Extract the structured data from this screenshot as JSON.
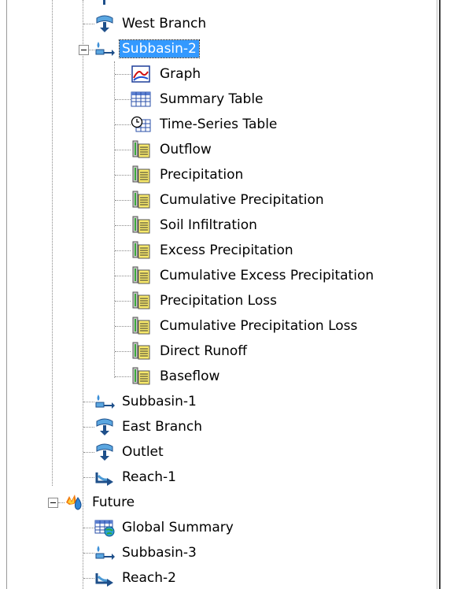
{
  "tree": {
    "nodes": [
      {
        "label": "West Branch",
        "icon": "junction-icon"
      },
      {
        "label": "Subbasin-2",
        "icon": "subbasin-icon",
        "selected": true,
        "expanded": true
      },
      {
        "label": "Graph",
        "icon": "graph-icon"
      },
      {
        "label": "Summary Table",
        "icon": "summary-table-icon"
      },
      {
        "label": "Time-Series Table",
        "icon": "time-series-table-icon"
      },
      {
        "label": "Outflow",
        "icon": "result-table-icon"
      },
      {
        "label": "Precipitation",
        "icon": "result-table-icon"
      },
      {
        "label": "Cumulative Precipitation",
        "icon": "result-table-icon"
      },
      {
        "label": "Soil Infiltration",
        "icon": "result-table-icon"
      },
      {
        "label": "Excess Precipitation",
        "icon": "result-table-icon"
      },
      {
        "label": "Cumulative Excess Precipitation",
        "icon": "result-table-icon"
      },
      {
        "label": "Precipitation Loss",
        "icon": "result-table-icon"
      },
      {
        "label": "Cumulative Precipitation Loss",
        "icon": "result-table-icon"
      },
      {
        "label": "Direct Runoff",
        "icon": "result-table-icon"
      },
      {
        "label": "Baseflow",
        "icon": "result-table-icon"
      },
      {
        "label": "Subbasin-1",
        "icon": "subbasin-icon"
      },
      {
        "label": "East Branch",
        "icon": "junction-icon"
      },
      {
        "label": "Outlet",
        "icon": "junction-icon"
      },
      {
        "label": "Reach-1",
        "icon": "reach-icon"
      },
      {
        "label": "Future",
        "icon": "simulation-run-icon",
        "expanded": true
      },
      {
        "label": "Global Summary",
        "icon": "global-summary-icon"
      },
      {
        "label": "Subbasin-3",
        "icon": "subbasin-icon"
      },
      {
        "label": "Reach-2",
        "icon": "reach-icon"
      }
    ]
  },
  "colors": {
    "selection": "#3399ff",
    "tree_lines": "#8a8a8a"
  }
}
